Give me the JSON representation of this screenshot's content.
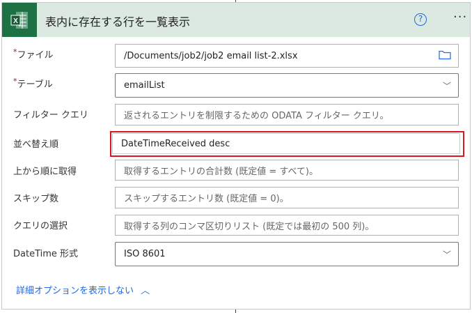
{
  "header": {
    "title": "表内に存在する行を一覧表示",
    "help": "?",
    "more": "···"
  },
  "fields": [
    {
      "label": "ファイル",
      "required": "*",
      "value": "/Documents/job2/job2 email list-2.xlsx"
    },
    {
      "label": "テーブル",
      "required": "*",
      "value": "emailList"
    },
    {
      "label": "フィルター クエリ",
      "placeholder": "返されるエントリを制限するための ODATA フィルター クエリ。"
    },
    {
      "label": "並べ替え順",
      "value": "DateTimeReceived desc"
    },
    {
      "label": "上から順に取得",
      "placeholder": "取得するエントリの合計数 (既定値 = すべて)。"
    },
    {
      "label": "スキップ数",
      "placeholder": "スキップするエントリ数 (既定値 = 0)。"
    },
    {
      "label": "クエリの選択",
      "placeholder": "取得する列のコンマ区切りリスト (既定では最初の 500 列)。"
    },
    {
      "label": "DateTime 形式",
      "value": "ISO 8601"
    }
  ],
  "advanced_link": "詳細オプションを表示しない",
  "colors": {
    "header_bg": "#dbe9e1",
    "excel_green": "#1e7145",
    "highlight": "#e0141e",
    "link": "#2266e3"
  }
}
